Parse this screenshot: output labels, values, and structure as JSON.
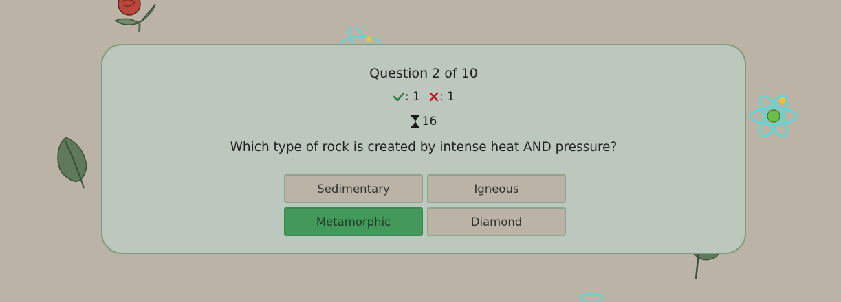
{
  "quiz": {
    "question_counter": "Question 2 of 10",
    "correct_count": ": 1",
    "wrong_count": ": 1",
    "timer_value": "16",
    "question_text": "Which type of rock is created by intense heat AND pressure?",
    "answers": [
      {
        "label": "Sedimentary",
        "selected": false
      },
      {
        "label": "Igneous",
        "selected": false
      },
      {
        "label": "Metamorphic",
        "selected": true
      },
      {
        "label": "Diamond",
        "selected": false
      }
    ]
  },
  "colors": {
    "background": "#bbb4a6",
    "card": "#bcc7bd",
    "card_border": "#7f9a7d",
    "selected_answer": "#43995a",
    "correct_icon": "#2e7d45",
    "wrong_icon": "#c1121f"
  },
  "icons": {
    "correct": "check-icon",
    "wrong": "x-icon",
    "timer": "hourglass-icon",
    "decorations": [
      "rose-icon",
      "leaf-icon",
      "atom-icon"
    ]
  }
}
